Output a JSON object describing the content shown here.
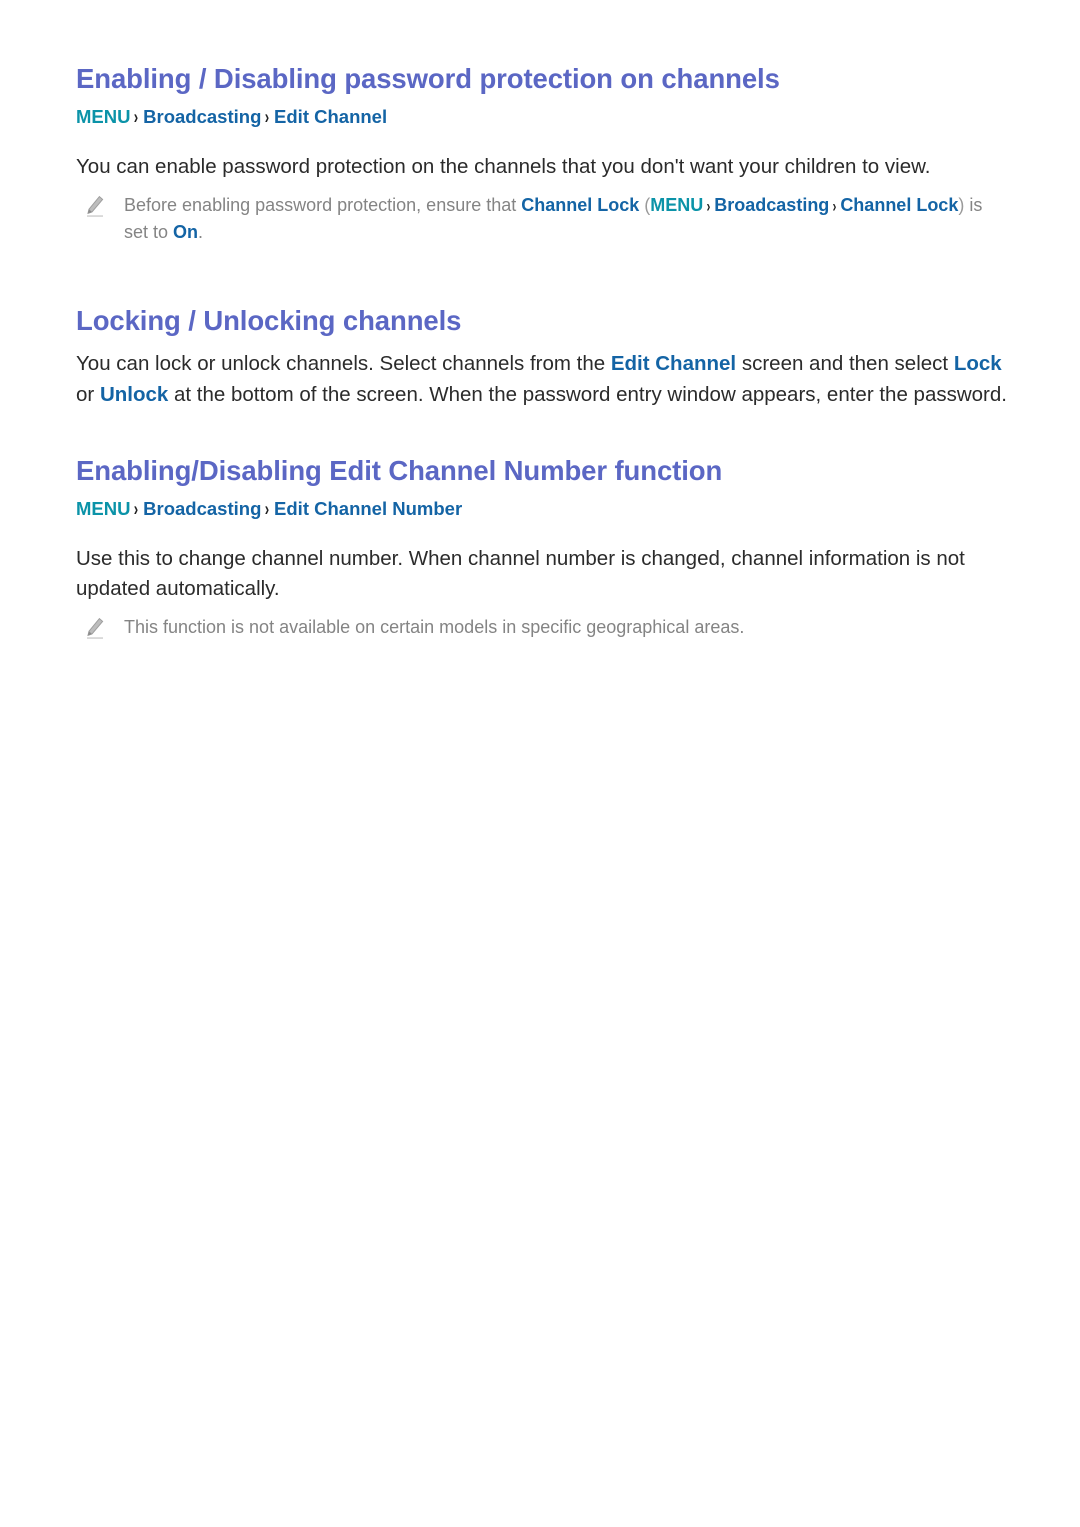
{
  "page": {
    "background_color": "#ffffff",
    "heading_color": "#5b67c4",
    "link_color": "#1464a5",
    "menu_color": "#0b93a8",
    "body_color": "#2b2b2b",
    "note_color": "#848484"
  },
  "sections": [
    {
      "id": "password-protection",
      "title": "Enabling / Disabling password protection on channels",
      "breadcrumb": {
        "menu": "MENU",
        "sep1": "›",
        "item1": "Broadcasting",
        "sep2": "›",
        "item2": "Edit Channel"
      },
      "paragraph": "You can enable password protection on the channels that you don't want your children to view.",
      "note": {
        "icon": "pencil-note-icon",
        "part1": "Before enabling password protection, ensure that ",
        "link1": "Channel Lock",
        "paren_open": " (",
        "menu": "MENU",
        "sep1": "›",
        "item1": "Broadcasting",
        "sep2": "›",
        "item2": "Channel Lock",
        "paren_close": ")",
        "part2": " is set to ",
        "link2": "On",
        "part3": "."
      }
    },
    {
      "id": "locking-unlocking",
      "title": "Locking / Unlocking channels",
      "paragraph_parts": {
        "p1": "You can lock or unlock channels. Select channels from the ",
        "l1": "Edit Channel",
        "p2": " screen and then select ",
        "l2": "Lock",
        "p3": " or ",
        "l3": "Unlock",
        "p4": " at the bottom of the screen. When the password entry window appears, enter the password."
      }
    },
    {
      "id": "edit-channel-number",
      "title": "Enabling/Disabling Edit Channel Number function",
      "breadcrumb": {
        "menu": "MENU",
        "sep1": "›",
        "item1": "Broadcasting",
        "sep2": "›",
        "item2": "Edit Channel Number"
      },
      "paragraph": "Use this to change channel number. When channel number is changed, channel information is not updated automatically.",
      "note": {
        "icon": "pencil-note-icon",
        "text": "This function is not available on certain models in specific geographical areas."
      }
    }
  ]
}
